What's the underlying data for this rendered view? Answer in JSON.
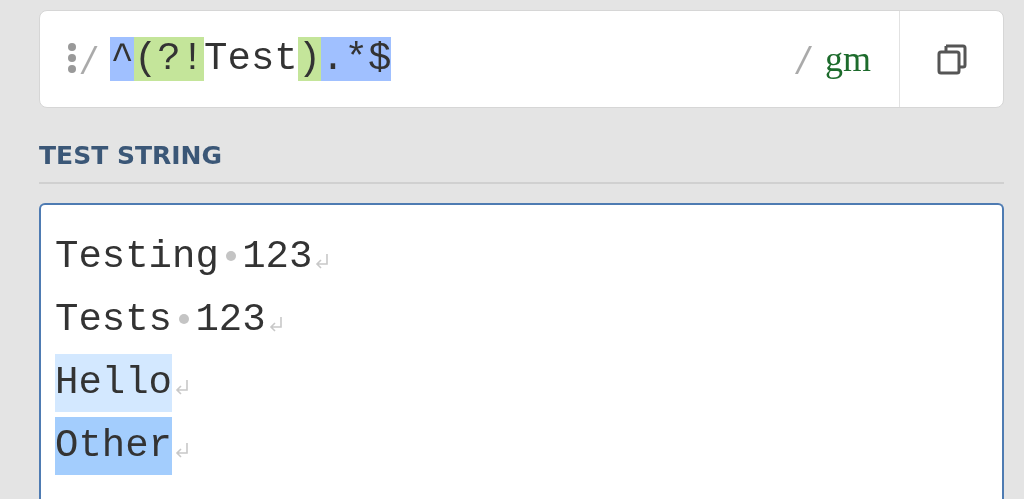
{
  "regex": {
    "delimiter_open": "/",
    "tokens": [
      {
        "text": "^",
        "color": "#a0c0ff"
      },
      {
        "text": "(?!",
        "color": "#c4e59a"
      },
      {
        "text": "Test"
      },
      {
        "text": ")",
        "color": "#c4e59a"
      },
      {
        "text": ".*$",
        "color": "#a0c0ff"
      }
    ],
    "delimiter_close": "/",
    "flags": "gm"
  },
  "test_string": {
    "heading": "TEST STRING",
    "lines": [
      {
        "text": "Testing 123"
      },
      {
        "text": "Tests 123"
      },
      {
        "text": "Hello",
        "color": "#d3e8ff"
      },
      {
        "text": "Other",
        "color": "#a3cdfd"
      }
    ]
  }
}
